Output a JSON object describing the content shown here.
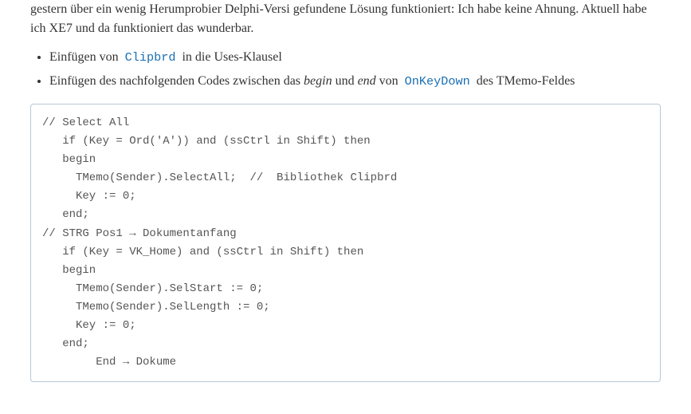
{
  "intro": {
    "line1_a": "gestern ",
    "line1_b": " über ein wenig ",
    "line1_c": " Herumprobier",
    "line1_d": " Delphi-Versi",
    "line2": "gefundene Lösung funktioniert: Ich habe keine Ahnung. Aktuell habe ich XE7 und da funktioniert das wunderbar."
  },
  "list": {
    "item1_a": "Einfügen von ",
    "item1_code": "Clipbrd",
    "item1_b": " in die Uses-Klausel",
    "item2_a": "Einfügen des nachfolgenden Codes zwischen das ",
    "item2_begin": "begin",
    "item2_b": " und ",
    "item2_end": "end",
    "item2_c": " von ",
    "item2_code": "OnKeyDown",
    "item2_d": " des TMemo-Feldes"
  },
  "code": "// Select All\n   if (Key = Ord('A')) and (ssCtrl in Shift) then\n   begin\n     TMemo(Sender).SelectAll;  //  Bibliothek Clipbrd\n     Key := 0;\n   end;\n// STRG Pos1 → Dokumentanfang\n   if (Key = VK_Home) and (ssCtrl in Shift) then\n   begin\n     TMemo(Sender).SelStart := 0;\n     TMemo(Sender).SelLength := 0;\n     Key := 0;\n   end;\n        End → Dokume"
}
